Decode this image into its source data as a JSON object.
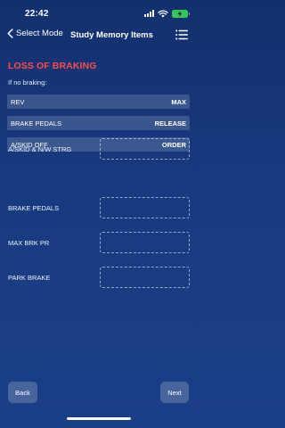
{
  "status_bar": {
    "time": "22:42"
  },
  "nav": {
    "back_label": "Select Mode",
    "title": "Study Memory Items"
  },
  "section": {
    "title": "LOSS OF BRAKING",
    "intro": "If no braking:"
  },
  "items": [
    {
      "label": "REV",
      "value": "MAX"
    },
    {
      "label": "BRAKE PEDALS",
      "value": "RELEASE"
    },
    {
      "label": "A/SKID OFF",
      "value": "ORDER"
    }
  ],
  "inputs": [
    {
      "label": "A/SKID & N/W STRG"
    },
    {
      "label": "BRAKE PEDALS"
    },
    {
      "label": "MAX BRK PR"
    },
    {
      "label": "PARK BRAKE"
    }
  ],
  "footer": {
    "back_label": "Back",
    "next_label": "Next"
  },
  "colors": {
    "accent_title": "#ff4a4a",
    "battery": "#34c759"
  }
}
